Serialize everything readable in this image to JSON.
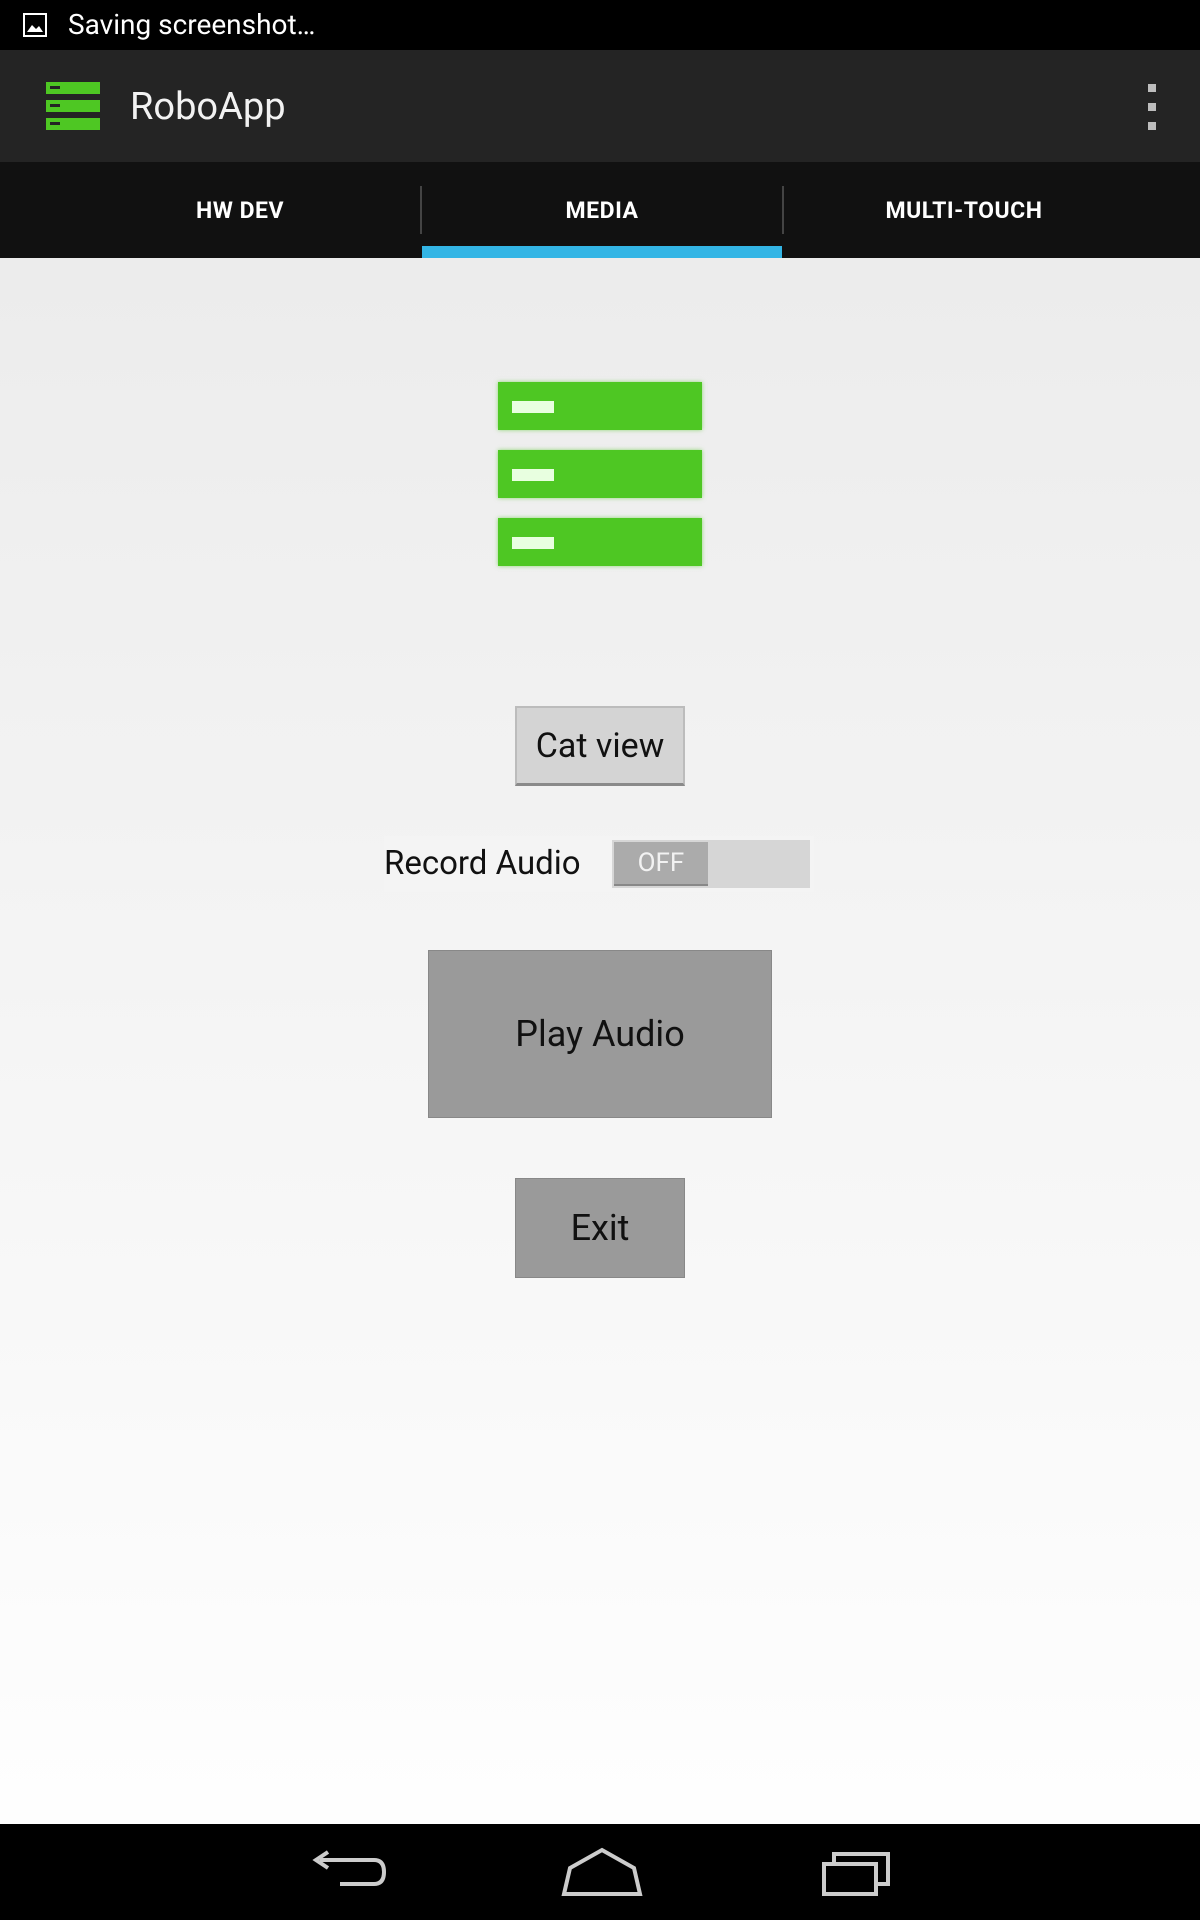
{
  "status_bar": {
    "notification_icon": "image-icon",
    "text": "Saving screenshot…"
  },
  "action_bar": {
    "app_icon": "app-logo-icon",
    "title": "RoboApp",
    "overflow_icon": "overflow-menu-icon"
  },
  "tabs": [
    {
      "label": "HW DEV",
      "selected": false
    },
    {
      "label": "MEDIA",
      "selected": true
    },
    {
      "label": "MULTI-TOUCH",
      "selected": false
    }
  ],
  "colors": {
    "tab_indicator": "#33b5e5",
    "logo_green": "#4ec723"
  },
  "media": {
    "logo_icon": "robo-logo-icon",
    "cat_view_label": "Cat view",
    "record_audio_label": "Record Audio",
    "record_toggle_state": "OFF",
    "play_audio_label": "Play Audio",
    "exit_label": "Exit"
  },
  "nav_bar": {
    "back_icon": "back-icon",
    "home_icon": "home-icon",
    "recents_icon": "recents-icon"
  }
}
